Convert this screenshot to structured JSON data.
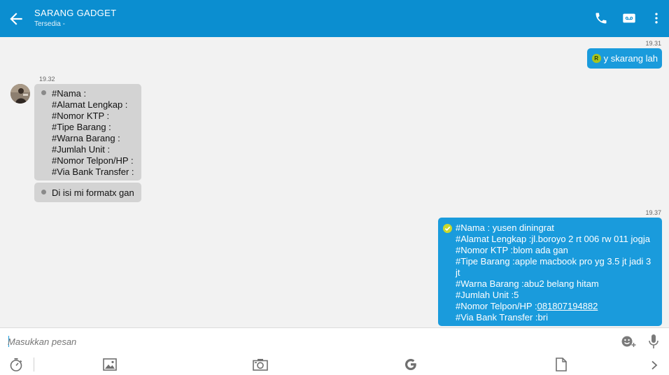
{
  "header": {
    "title": "SARANG GADGET",
    "status": "Tersedia -",
    "colors": {
      "bar": "#0b8ed0"
    }
  },
  "icons": {
    "back": "arrow-back-icon",
    "call": "phone-icon",
    "video": "voicemail-icon",
    "menu": "more-vertical-icon"
  },
  "messages": [
    {
      "direction": "out",
      "time": "19.31",
      "badge": "R",
      "lines": [
        "y skarang lah"
      ]
    },
    {
      "direction": "in",
      "time": "19.32",
      "lines": [
        "#Nama :",
        "#Alamat Lengkap :",
        "#Nomor KTP :",
        "#Tipe Barang :",
        "#Warna Barang :",
        "#Jumlah Unit :",
        "#Nomor Telpon/HP :",
        "#Via Bank Transfer :"
      ]
    },
    {
      "direction": "in",
      "lines": [
        "Di isi mi formatx gan"
      ]
    },
    {
      "direction": "out",
      "time": "19.37",
      "lines": [
        "#Nama : yusen diningrat",
        "#Alamat Lengkap :jl.boroyo 2 rt 006 rw 011 jogja",
        "#Nomor KTP :blom ada gan",
        "#Tipe Barang :apple macbook pro yg 3.5 jt jadi 3",
        "jt",
        "#Warna Barang :abu2 belang hitam",
        "#Jumlah Unit :5"
      ],
      "phone_prefix": "#Nomor Telpon/HP :",
      "phone": "081807194882",
      "last_line": "#Via Bank Transfer :bri"
    }
  ],
  "composer": {
    "placeholder": "Masukkan pesan"
  },
  "toolbar": [
    "timer-icon",
    "image-icon",
    "camera-icon",
    "google-icon",
    "file-icon",
    "chevron-right-icon"
  ]
}
